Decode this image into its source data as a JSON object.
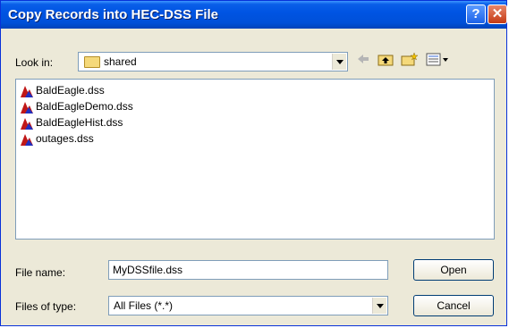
{
  "dialog": {
    "title": "Copy Records into HEC-DSS File",
    "help_label": "?",
    "close_label": "✕"
  },
  "look_in": {
    "label": "Look in:",
    "value": "shared"
  },
  "toolbar_icons": [
    "back-icon",
    "up-folder-icon",
    "new-folder-icon",
    "view-menu-icon"
  ],
  "files": [
    {
      "name": "BaldEagle.dss"
    },
    {
      "name": "BaldEagleDemo.dss"
    },
    {
      "name": "BaldEagleHist.dss"
    },
    {
      "name": "outages.dss"
    }
  ],
  "file_name": {
    "label": "File name:",
    "value": "MyDSSfile.dss"
  },
  "files_of_type": {
    "label": "Files of type:",
    "value": "All Files (*.*)"
  },
  "buttons": {
    "open": "Open",
    "cancel": "Cancel"
  },
  "colors": {
    "title_bar": "#0054e3",
    "dialog_bg": "#ece9d8"
  }
}
